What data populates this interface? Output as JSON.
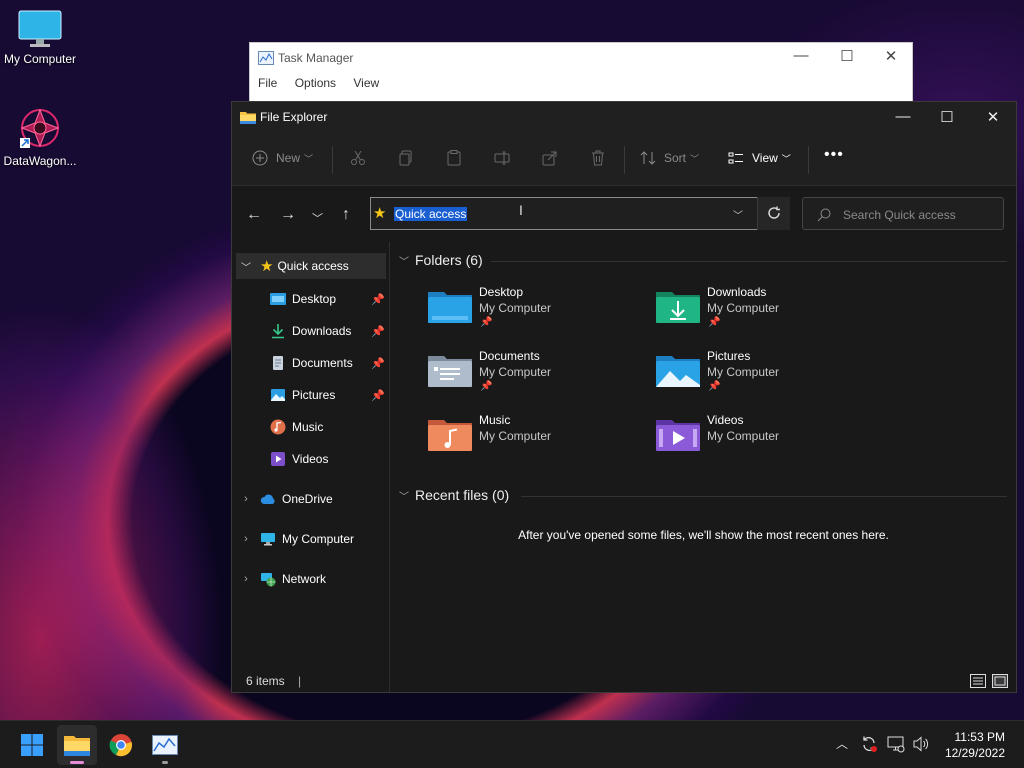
{
  "desktop": {
    "icons": [
      {
        "label": "My Computer",
        "icon": "monitor-icon"
      },
      {
        "label": "DataWagon...",
        "icon": "datawagon-icon"
      }
    ]
  },
  "task_manager": {
    "title": "Task Manager",
    "menu": [
      "File",
      "Options",
      "View"
    ]
  },
  "explorer": {
    "title": "File Explorer",
    "toolbar": {
      "new_label": "New",
      "sort_label": "Sort",
      "view_label": "View",
      "more_label": "•••"
    },
    "address": {
      "value": "Quick access"
    },
    "search": {
      "placeholder": "Search Quick access"
    },
    "nav": {
      "quick_access": "Quick access",
      "pinned": [
        "Desktop",
        "Downloads",
        "Documents",
        "Pictures",
        "Music",
        "Videos"
      ],
      "onedrive": "OneDrive",
      "my_computer": "My Computer",
      "network": "Network"
    },
    "folders_header": "Folders (6)",
    "folders": [
      {
        "name": "Desktop",
        "location": "My Computer",
        "pinned": true,
        "color": "#1f8fd4"
      },
      {
        "name": "Downloads",
        "location": "My Computer",
        "pinned": true,
        "color": "#1aa37a"
      },
      {
        "name": "Documents",
        "location": "My Computer",
        "pinned": true,
        "color": "#8a9bb0"
      },
      {
        "name": "Pictures",
        "location": "My Computer",
        "pinned": true,
        "color": "#1f8fd4"
      },
      {
        "name": "Music",
        "location": "My Computer",
        "pinned": false,
        "color": "#e0704a"
      },
      {
        "name": "Videos",
        "location": "My Computer",
        "pinned": false,
        "color": "#7d4ec9"
      }
    ],
    "recent_header": "Recent files (0)",
    "recent_empty": "After you've opened some files, we'll show the most recent ones here.",
    "status": "6 items"
  },
  "taskbar": {
    "time": "11:53 PM",
    "date": "12/29/2022"
  }
}
